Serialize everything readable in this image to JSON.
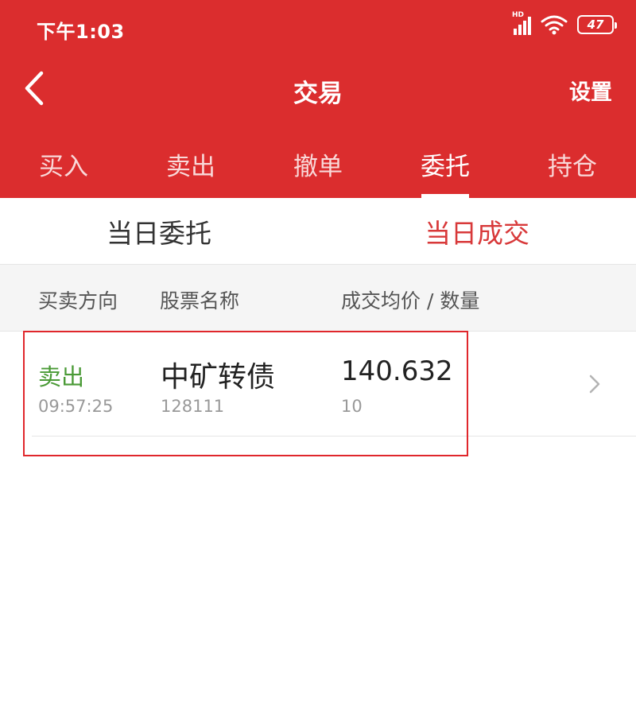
{
  "status_bar": {
    "time": "下午1:03",
    "hd": "HD",
    "battery": "47"
  },
  "header": {
    "title": "交易",
    "settings_label": "设置"
  },
  "tabs": [
    {
      "label": "买入",
      "active": false
    },
    {
      "label": "卖出",
      "active": false
    },
    {
      "label": "撤单",
      "active": false
    },
    {
      "label": "委托",
      "active": true
    },
    {
      "label": "持仓",
      "active": false
    }
  ],
  "subtabs": [
    {
      "label": "当日委托",
      "active": false
    },
    {
      "label": "当日成交",
      "active": true
    }
  ],
  "columns": {
    "direction": "买卖方向",
    "stock_name": "股票名称",
    "price_qty": "成交均价 / 数量"
  },
  "trades": [
    {
      "direction": "卖出",
      "time": "09:57:25",
      "name": "中矿转债",
      "code": "128111",
      "avg_price": "140.632",
      "quantity": "10"
    }
  ],
  "colors": {
    "header_red": "#db2d2e",
    "active_subtab": "#d8393a",
    "sell_green": "#4a9a36",
    "highlight_box": "#e0272c"
  },
  "icons": {
    "back": "chevron-left-icon",
    "row_arrow": "chevron-right-icon",
    "wifi": "wifi-icon",
    "signal": "signal-icon",
    "battery": "battery-icon"
  }
}
